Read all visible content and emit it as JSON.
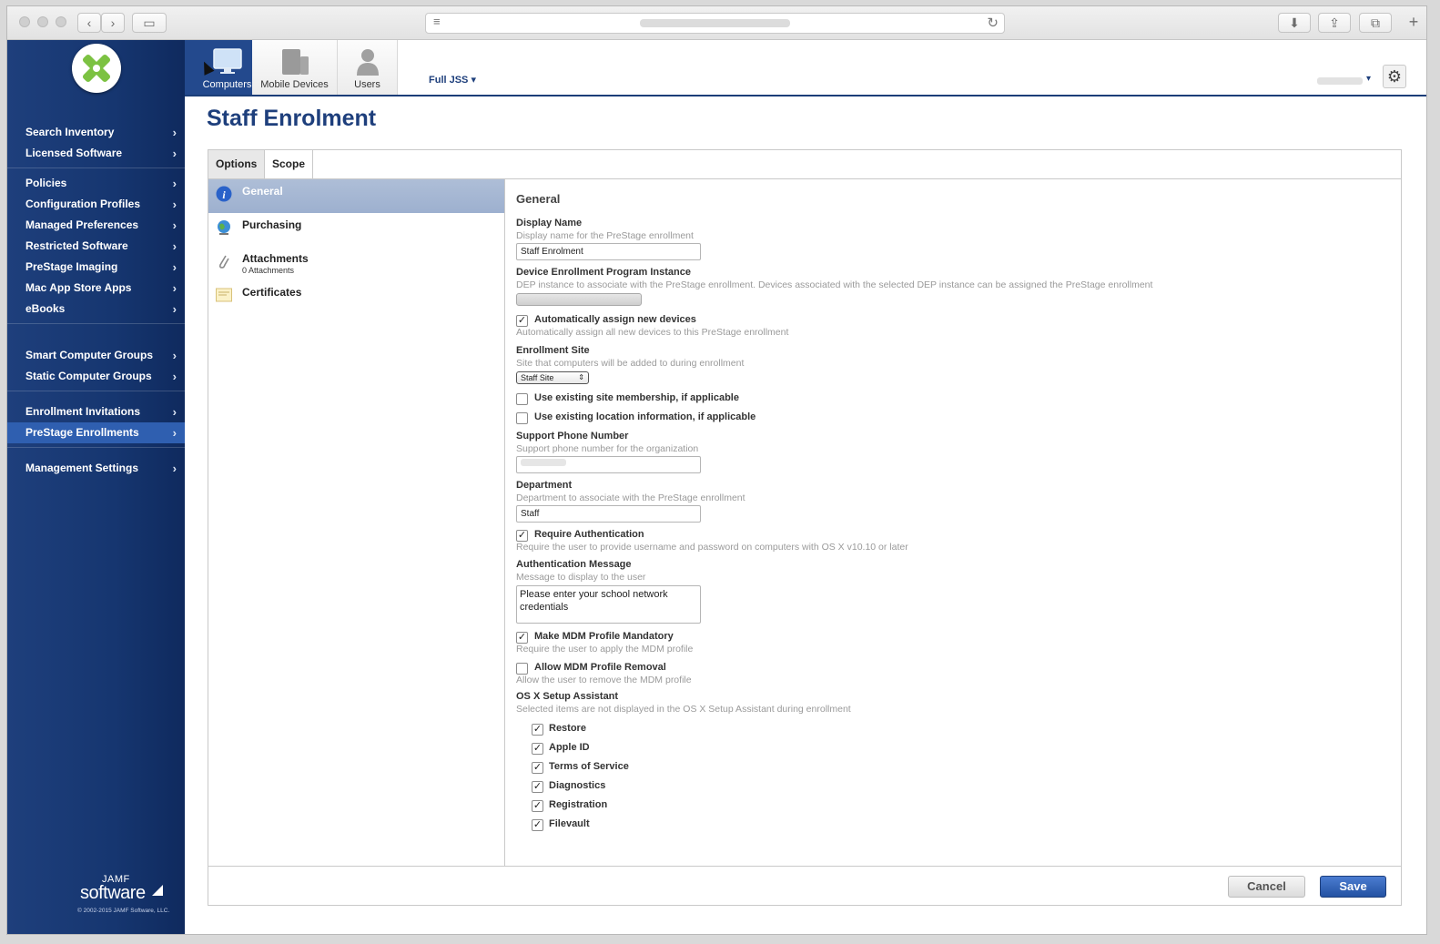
{
  "sidebar": {
    "groups": [
      [
        "Search Inventory",
        "Licensed Software"
      ],
      [
        "Policies",
        "Configuration Profiles",
        "Managed Preferences",
        "Restricted Software",
        "PreStage Imaging",
        "Mac App Store Apps",
        "eBooks"
      ],
      [
        "Smart Computer Groups",
        "Static Computer Groups"
      ],
      [
        "Enrollment Invitations",
        "PreStage Enrollments"
      ],
      [
        "Management Settings"
      ]
    ],
    "active_item": "PreStage Enrollments",
    "brand_top": "JAMF",
    "brand_bottom": "software",
    "copyright": "© 2002-2015 JAMF Software, LLC."
  },
  "topnav": {
    "tabs": [
      {
        "label": "Computers",
        "icon": "computer-icon"
      },
      {
        "label": "Mobile Devices",
        "icon": "mobile-devices-icon"
      },
      {
        "label": "Users",
        "icon": "user-icon"
      }
    ],
    "site_selector": "Full JSS ▾",
    "user_menu_arrow": "▾"
  },
  "page": {
    "title": "Staff Enrolment"
  },
  "option_tabs": [
    "Options",
    "Scope"
  ],
  "left_list": [
    {
      "label": "General",
      "sub": "",
      "icon": "info-icon",
      "active": true
    },
    {
      "label": "Purchasing",
      "sub": "",
      "icon": "globe-icon",
      "active": false
    },
    {
      "label": "Attachments",
      "sub": "0 Attachments",
      "icon": "paperclip-icon",
      "active": false
    },
    {
      "label": "Certificates",
      "sub": "",
      "icon": "certificate-icon",
      "active": false
    }
  ],
  "form": {
    "section_title": "General",
    "display_name": {
      "label": "Display Name",
      "help": "Display name for the PreStage enrollment",
      "value": "Staff Enrolment"
    },
    "dep_instance": {
      "label": "Device Enrollment Program Instance",
      "help": "DEP instance to associate with the PreStage enrollment. Devices associated with the selected DEP instance can be assigned the PreStage enrollment"
    },
    "auto_assign": {
      "label": "Automatically assign new devices",
      "help": "Automatically assign all new devices to this PreStage enrollment",
      "checked": true
    },
    "enrollment_site": {
      "label": "Enrollment Site",
      "help": "Site that computers will be added to during enrollment",
      "value": "Staff Site"
    },
    "use_site_membership": {
      "label": "Use existing site membership, if applicable",
      "checked": false
    },
    "use_location_info": {
      "label": "Use existing location information, if applicable",
      "checked": false
    },
    "support_phone": {
      "label": "Support Phone Number",
      "help": "Support phone number for the organization"
    },
    "department": {
      "label": "Department",
      "help": "Department to associate with the PreStage enrollment",
      "value": "Staff"
    },
    "require_auth": {
      "label": "Require Authentication",
      "help": "Require the user to provide username and password on computers with OS X v10.10 or later",
      "checked": true
    },
    "auth_message": {
      "label": "Authentication Message",
      "help": "Message to display to the user",
      "value": "Please enter your school network credentials"
    },
    "mdm_mandatory": {
      "label": "Make MDM Profile Mandatory",
      "help": "Require the user to apply the MDM profile",
      "checked": true
    },
    "mdm_removal": {
      "label": "Allow MDM Profile Removal",
      "help": "Allow the user to remove the MDM profile",
      "checked": false
    },
    "setup_assistant": {
      "label": "OS X Setup Assistant",
      "help": "Selected items are not displayed in the OS X Setup Assistant during enrollment",
      "items": [
        {
          "label": "Restore",
          "checked": true
        },
        {
          "label": "Apple ID",
          "checked": true
        },
        {
          "label": "Terms of Service",
          "checked": true
        },
        {
          "label": "Diagnostics",
          "checked": true
        },
        {
          "label": "Registration",
          "checked": true
        },
        {
          "label": "Filevault",
          "checked": true
        }
      ]
    }
  },
  "buttons": {
    "cancel": "Cancel",
    "save": "Save"
  },
  "icons": {
    "check": "✓",
    "chevron": "›",
    "gear": "⚙",
    "select_arrows": "⇕"
  },
  "colors": {
    "sidebar": "#163670",
    "accent": "#1e3f7c",
    "active_nav": "#2f5fb0",
    "save": "#2352a3"
  }
}
